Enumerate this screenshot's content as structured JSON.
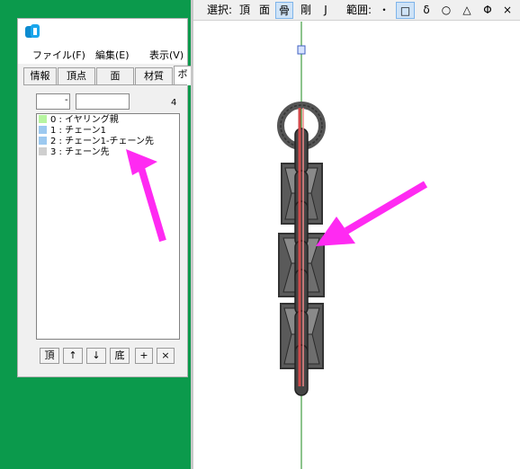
{
  "panel": {
    "menu": [
      {
        "label": "ファイル(F)"
      },
      {
        "label": "編集(E)"
      },
      {
        "label": "表示(V)"
      }
    ],
    "tabs": [
      {
        "label": "情報"
      },
      {
        "label": "頂点"
      },
      {
        "label": "面"
      },
      {
        "label": "材質"
      },
      {
        "label": "ボ"
      }
    ],
    "range_separator": "-",
    "count": "4",
    "bones": [
      {
        "label": "0 : イヤリング親",
        "color": "#b7f5a0"
      },
      {
        "label": "1 : チェーン1",
        "color": "#9cc9f0"
      },
      {
        "label": "2 : チェーン1-チェーン先",
        "color": "#9cc9f0"
      },
      {
        "label": "3 : チェーン先",
        "color": "#cfcfcf"
      }
    ],
    "buttons": [
      {
        "label": "頂"
      },
      {
        "label": "↑"
      },
      {
        "label": "↓"
      },
      {
        "label": "底"
      },
      {
        "label": "+"
      },
      {
        "label": "×"
      }
    ]
  },
  "toolbar": {
    "select_label": "選択:",
    "modes": [
      {
        "label": "頂"
      },
      {
        "label": "面"
      },
      {
        "label": "骨"
      },
      {
        "label": "剛"
      },
      {
        "label": "J"
      }
    ],
    "range_label": "範囲:",
    "shapes": [
      {
        "label": "・"
      },
      {
        "label": "□"
      },
      {
        "label": "δ"
      },
      {
        "label": "○"
      },
      {
        "label": "△"
      },
      {
        "label": "Φ"
      },
      {
        "label": "×"
      }
    ]
  },
  "colors": {
    "background": "#0b9a4c",
    "arrow": "#ff2af2",
    "axis": "#1a8a1a",
    "bone": "#d04a4a"
  }
}
